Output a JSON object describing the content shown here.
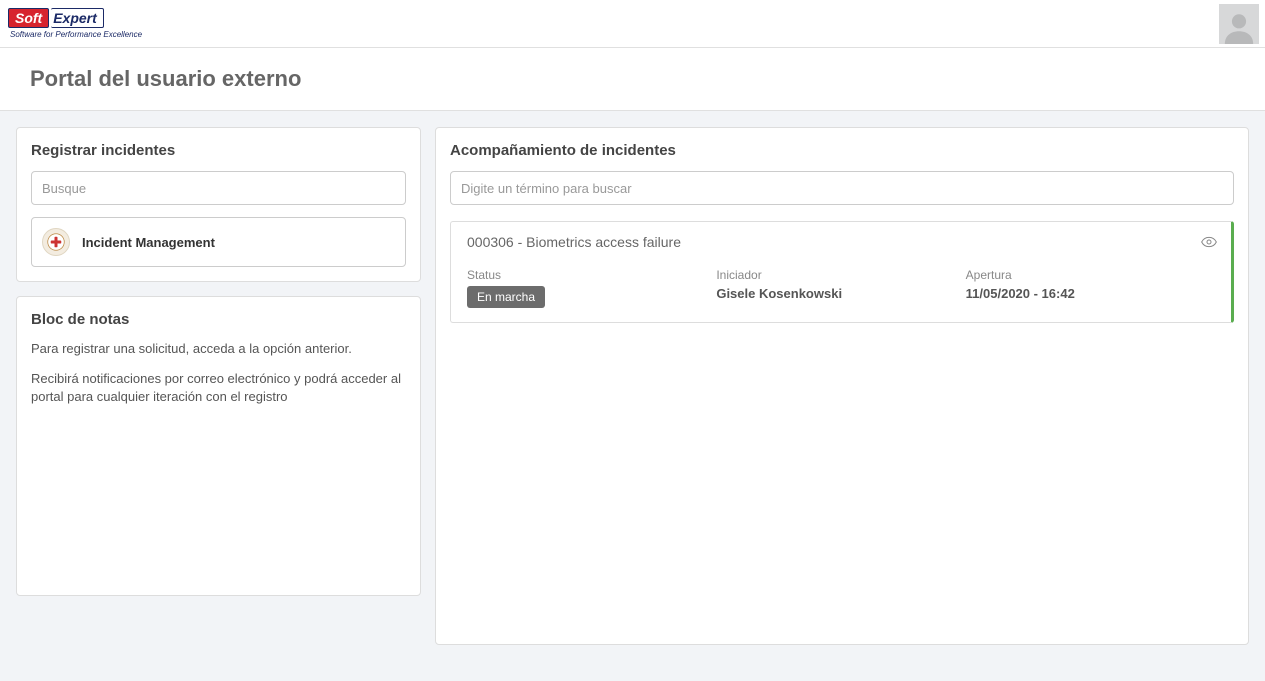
{
  "logo": {
    "part1": "Soft",
    "part2": "Expert",
    "tagline": "Software for Performance Excellence"
  },
  "page": {
    "title": "Portal del usuario externo"
  },
  "register": {
    "title": "Registrar incidentes",
    "search_placeholder": "Busque",
    "category_label": "Incident Management"
  },
  "notes": {
    "title": "Bloc de notas",
    "p1": "Para registrar una solicitud, acceda a la opción anterior.",
    "p2": "Recibirá notificaciones por correo electrónico y podrá acceder al portal para cualquier iteración con el registro"
  },
  "tracking": {
    "title": "Acompañamiento de incidentes",
    "search_placeholder": "Digite un término para buscar",
    "incident": {
      "title": "000306 - Biometrics access failure",
      "status_label": "Status",
      "status_value": "En marcha",
      "initiator_label": "Iniciador",
      "initiator_value": "Gisele Kosenkowski",
      "opened_label": "Apertura",
      "opened_value": "11/05/2020 - 16:42"
    }
  }
}
